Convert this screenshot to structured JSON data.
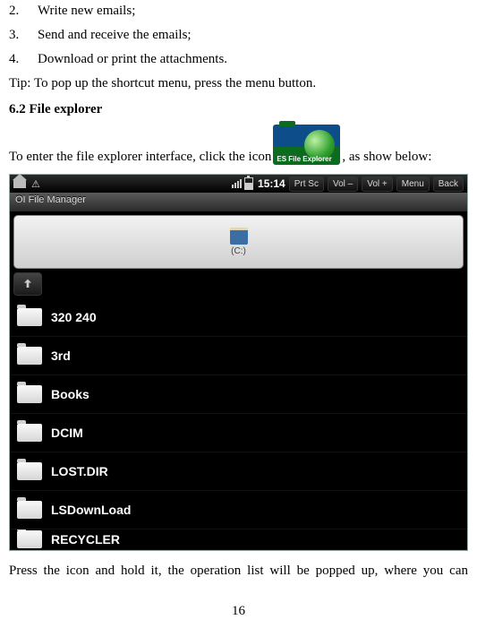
{
  "list": {
    "n2": "2.",
    "t2": "Write new emails;",
    "n3": "3.",
    "t3": "Send and receive the emails;",
    "n4": "4.",
    "t4": "Download or print the attachments."
  },
  "tip": "Tip: To pop up the shortcut menu, press the menu button.",
  "sectionHeader": "6.2 File explorer",
  "enterPrefix": "To enter the file explorer interface, click the icon",
  "enterSuffix": ", as show below:",
  "esLabel": "ES File Explorer",
  "shot": {
    "time": "15:14",
    "buttons": {
      "prtsc": "Prt Sc",
      "voldown": "Vol –",
      "volup": "Vol +",
      "menu": "Menu",
      "back": "Back"
    },
    "title": "OI File Manager",
    "driveLabel": "(C:)",
    "items": [
      "320 240",
      "3rd",
      "Books",
      "DCIM",
      "LOST.DIR",
      "LSDownLoad",
      "RECYCLER"
    ]
  },
  "bottomText": "Press the icon and hold it, the operation list will be popped up, where you can",
  "pageNumber": "16"
}
